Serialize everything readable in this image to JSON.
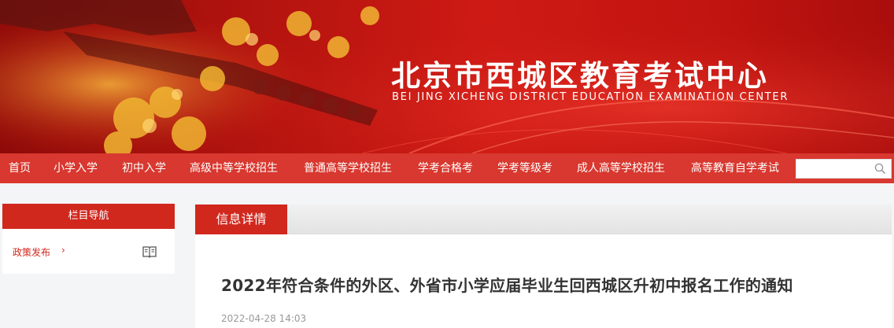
{
  "header": {
    "title": "北京市西城区教育考试中心",
    "subtitle": "BEI JING XICHENG DISTRICT EDUCATION EXAMINATION  CENTER"
  },
  "nav": {
    "items": [
      {
        "label": "首页"
      },
      {
        "label": "小学入学"
      },
      {
        "label": "初中入学"
      },
      {
        "label": "高级中等学校招生"
      },
      {
        "label": "普通高等学校招生"
      },
      {
        "label": "学考合格考"
      },
      {
        "label": "学考等级考"
      },
      {
        "label": "成人高等学校招生"
      },
      {
        "label": "高等教育自学考试"
      }
    ],
    "search": {
      "placeholder": "",
      "icon": "search-icon"
    }
  },
  "sidebar": {
    "heading": "栏目导航",
    "items": [
      {
        "label": "政策发布",
        "arrow": "›",
        "icon": "book-icon"
      }
    ]
  },
  "main": {
    "tab_label": "信息详情",
    "article": {
      "title": "2022年符合条件的外区、外省市小学应届毕业生回西城区升初中报名工作的通知",
      "date": "2022-04-28 14:03"
    }
  },
  "colors": {
    "brand_red": "#d1281e",
    "nav_red": "#d8382f",
    "banner_red": "#cf1a14"
  }
}
